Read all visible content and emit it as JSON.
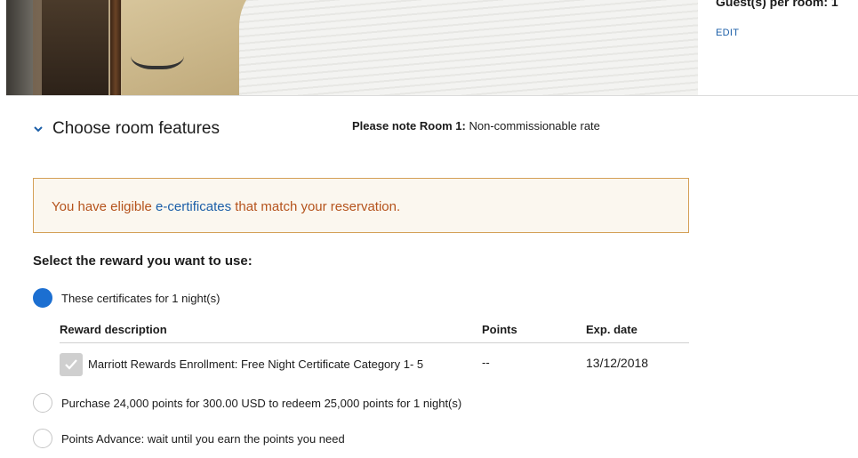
{
  "booking": {
    "guests_label": "Guest(s) per room: 1",
    "edit_label": "EDIT"
  },
  "section": {
    "title": "Choose room features",
    "note_prefix": "Please note Room 1:",
    "note_text": "Non-commissionable rate"
  },
  "alert": {
    "before": "You have eligible ",
    "link": "e-certificates",
    "after": " that match your reservation."
  },
  "reward": {
    "prompt": "Select the reward you want to use:",
    "options": [
      {
        "label": "These certificates for 1 night(s)",
        "selected": true
      },
      {
        "label": "Purchase 24,000 points for 300.00 USD to redeem 25,000 points for 1 night(s)",
        "selected": false
      },
      {
        "label": "Points Advance: wait until you earn the points you need",
        "selected": false
      }
    ],
    "table": {
      "headers": [
        "Reward description",
        "Points",
        "Exp. date"
      ],
      "rows": [
        {
          "description": "Marriott Rewards Enrollment: Free Night Certificate Category 1- 5",
          "points": "--",
          "exp_date": "13/12/2018"
        }
      ]
    }
  },
  "colors": {
    "accent": "#1c6fd1",
    "link": "#1c5fa8",
    "alert_text": "#b5531c",
    "alert_border": "#d4a057"
  },
  "icons": {
    "section_toggle": "chevron-down-icon",
    "row_check": "checkmark-icon"
  }
}
